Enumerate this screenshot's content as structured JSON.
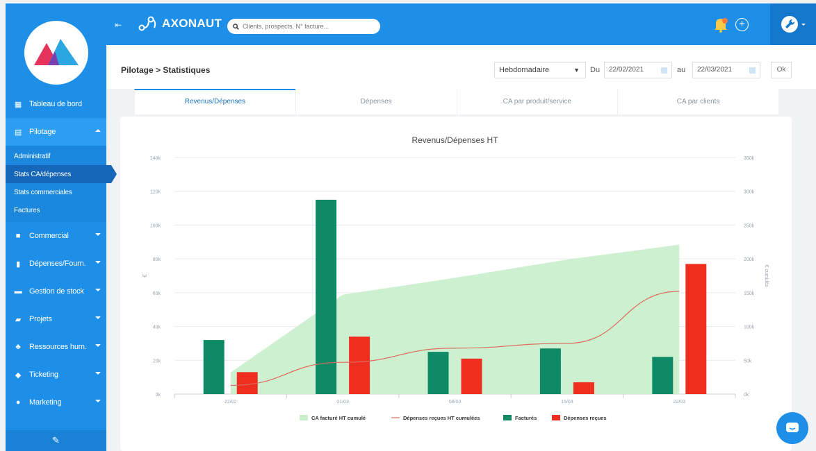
{
  "app": {
    "brand": "AXONAUT",
    "search_placeholder": "Clients, prospects, N° facture..."
  },
  "sidebar": {
    "items": [
      {
        "label": "Tableau de bord",
        "icon": "dashboard-icon"
      },
      {
        "label": "Pilotage",
        "icon": "chart-icon",
        "expanded": true,
        "children": [
          {
            "label": "Administratif"
          },
          {
            "label": "Stats CA/dépenses",
            "current": true
          },
          {
            "label": "Stats commerciales"
          },
          {
            "label": "Factures"
          }
        ]
      },
      {
        "label": "Commercial",
        "icon": "briefcase-icon"
      },
      {
        "label": "Dépenses/Fourn.",
        "icon": "receipt-icon"
      },
      {
        "label": "Gestion de stock",
        "icon": "box-icon"
      },
      {
        "label": "Projets",
        "icon": "folder-icon"
      },
      {
        "label": "Ressources hum.",
        "icon": "people-icon"
      },
      {
        "label": "Ticketing",
        "icon": "ticket-icon"
      },
      {
        "label": "Marketing",
        "icon": "megaphone-icon"
      }
    ]
  },
  "header": {
    "breadcrumb": "Pilotage > Statistiques",
    "period": "Hebdomadaire",
    "du_label": "Du",
    "date_from": "22/02/2021",
    "au_label": "au",
    "date_to": "22/03/2021",
    "ok_label": "Ok"
  },
  "tabs": [
    {
      "label": "Revenus/Dépenses",
      "active": true
    },
    {
      "label": "Dépenses",
      "active": false
    },
    {
      "label": "CA par produit/service",
      "active": false
    },
    {
      "label": "CA par clients",
      "active": false
    }
  ],
  "colors": {
    "factures": "#0e8a66",
    "depenses": "#ee2f1f",
    "ca_cumule": "#c8eecb",
    "depenses_cumulees": "#e06a5e",
    "accent": "#1d8fe8"
  },
  "chart_data": {
    "type": "bar",
    "title": "Revenus/Dépenses HT",
    "ylabel": "€",
    "y2label": "€ cumulés",
    "categories": [
      "22/02",
      "01/03",
      "08/03",
      "15/03",
      "22/03"
    ],
    "ylim": [
      0,
      140000
    ],
    "y2lim": [
      0,
      350000
    ],
    "yticks": [
      "0k",
      "20k",
      "40k",
      "60k",
      "80k",
      "100k",
      "120k",
      "140k"
    ],
    "y2ticks": [
      "0k",
      "50k",
      "100k",
      "150k",
      "200k",
      "250k",
      "300k",
      "350k"
    ],
    "series": [
      {
        "name": "Facturés",
        "type": "bar",
        "axis": "left",
        "values": [
          32000,
          115000,
          25000,
          27000,
          22000
        ]
      },
      {
        "name": "Dépenses reçues",
        "type": "bar",
        "axis": "left",
        "values": [
          13000,
          34000,
          21000,
          7000,
          77000
        ]
      },
      {
        "name": "CA facturé HT cumulé",
        "type": "area",
        "axis": "right",
        "values": [
          32000,
          147000,
          172000,
          199000,
          221000
        ]
      },
      {
        "name": "Dépenses reçues HT cumulées",
        "type": "line",
        "axis": "right",
        "values": [
          13000,
          47000,
          68000,
          75000,
          152000
        ]
      }
    ],
    "grid": true,
    "legend_position": "bottom"
  }
}
